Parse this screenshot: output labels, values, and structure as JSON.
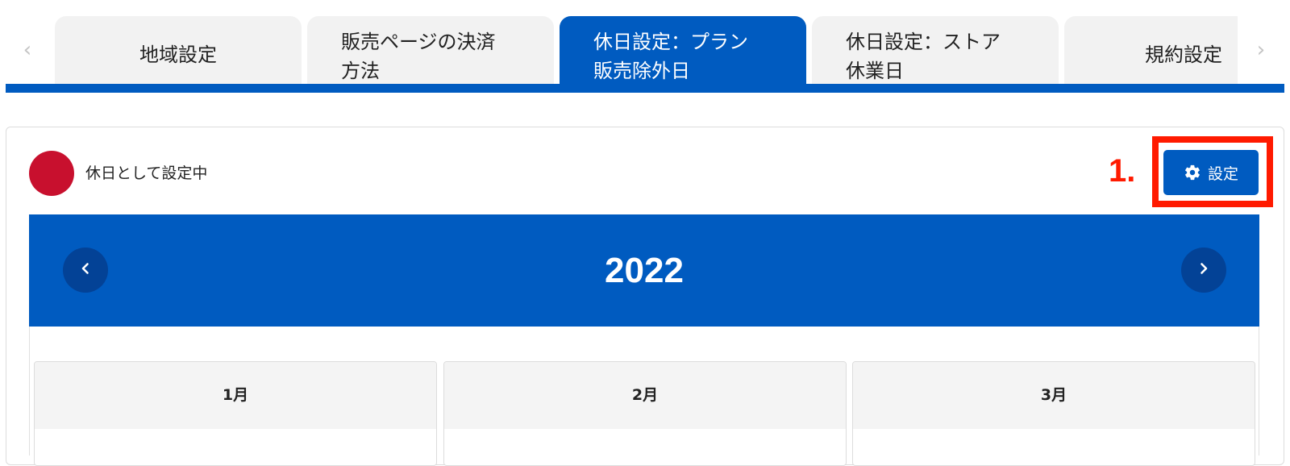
{
  "tabs": {
    "items": [
      {
        "label": "地域設定",
        "active": false
      },
      {
        "label": "販売ページの決済方法",
        "line1": "販売ページの決済",
        "line2": "方法",
        "active": false
      },
      {
        "label": "休日設定：プラン販売除外日",
        "line1": "休日設定：プラン",
        "line2": "販売除外日",
        "active": true
      },
      {
        "label": "休日設定：ストア休業日",
        "line1": "休日設定：ストア",
        "line2": "休業日",
        "active": false
      },
      {
        "label": "規約設定",
        "active": false
      }
    ],
    "prev_arrow": "‹",
    "next_arrow": "›"
  },
  "legend": {
    "text": "休日として設定中",
    "color": "#c8102e"
  },
  "annotation": {
    "step": "1."
  },
  "settings_button": {
    "label": "設定",
    "icon": "gear-icon"
  },
  "calendar": {
    "year": "2022",
    "months": [
      {
        "label": "1月"
      },
      {
        "label": "2月"
      },
      {
        "label": "3月"
      }
    ]
  },
  "colors": {
    "accent": "#005bc0",
    "nav_circle": "#034296",
    "holiday": "#c8102e",
    "annotation": "#ff1a00"
  }
}
